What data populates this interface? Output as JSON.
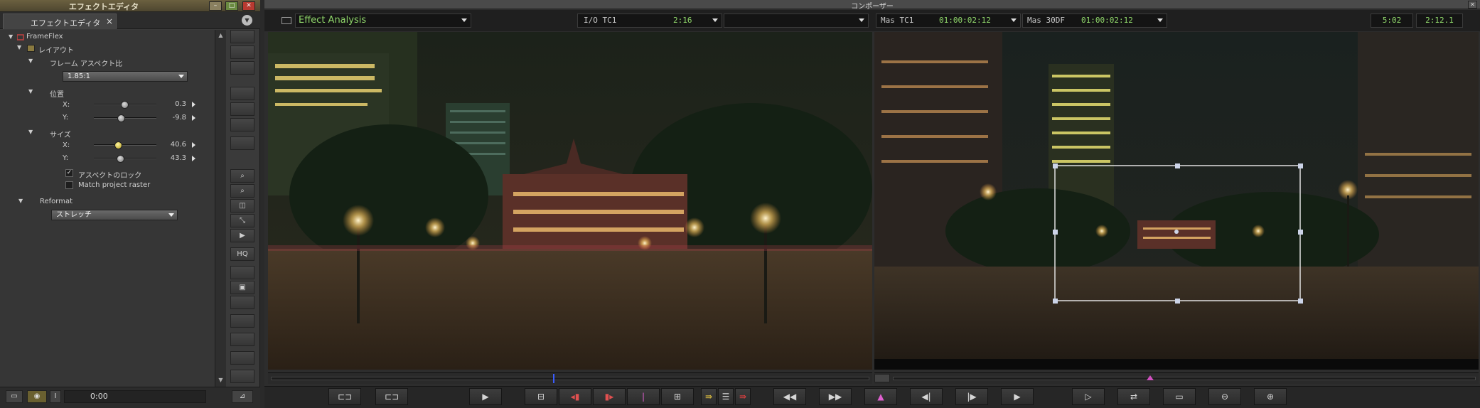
{
  "effect_editor": {
    "window_title": "エフェクトエディタ",
    "tab_label": "エフェクトエディタ",
    "tree": {
      "root": "FrameFlex",
      "layout_label": "レイアウト",
      "aspect_label": "フレーム アスペクト比",
      "aspect_value": "1.85:1",
      "position_label": "位置",
      "position_x_label": "X:",
      "position_x": "0.3",
      "position_y_label": "Y:",
      "position_y": "-9.8",
      "size_label": "サイズ",
      "size_x_label": "X:",
      "size_x": "40.6",
      "size_y_label": "Y:",
      "size_y": "43.3",
      "lock_aspect_label": "アスペクトのロック",
      "match_raster_label": "Match project raster",
      "reformat_label": "Reformat",
      "reformat_value": "ストレッチ"
    },
    "tools": {
      "hq_label": "HQ"
    },
    "bottom": {
      "timecode": "0:00"
    }
  },
  "composer": {
    "window_title": "コンポーザー",
    "source_menu": "Effect Analysis",
    "io_label": "I/O TC1",
    "io_value": "2:16",
    "mas_tc1_label": "Mas TC1",
    "mas_tc1_value": "01:00:02:12",
    "mas_30df_label": "Mas 30DF",
    "mas_30df_value": "01:00:02:12",
    "right_tc1": "5:02",
    "right_tc2": "2:12.1"
  },
  "colors": {
    "accent_green": "#8fd66a",
    "title_gold": "#6b6040",
    "close_red": "#b83a30"
  }
}
